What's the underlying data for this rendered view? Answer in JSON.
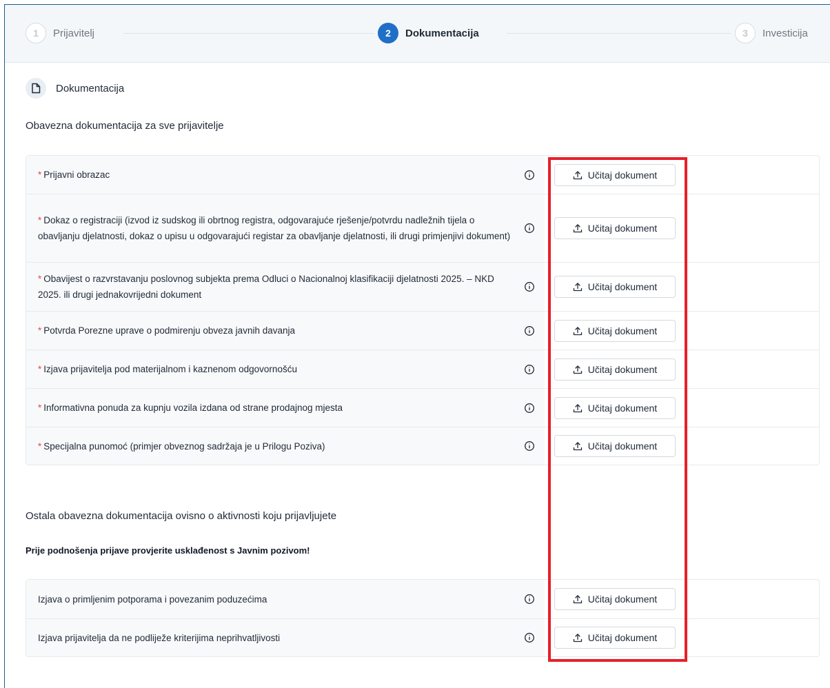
{
  "top_strip_text": "",
  "stepper": {
    "steps": [
      {
        "number": "1",
        "label": "Prijavitelj",
        "state": "inactive"
      },
      {
        "number": "2",
        "label": "Dokumentacija",
        "state": "active"
      },
      {
        "number": "3",
        "label": "Investicija",
        "state": "inactive"
      }
    ]
  },
  "section": {
    "icon": "document-icon",
    "title": "Dokumentacija"
  },
  "groups": [
    {
      "title": "Obavezna dokumentacija za sve prijavitelje",
      "warning": "",
      "rows": [
        {
          "required": "*",
          "label": "Prijavni obrazac",
          "button": "Učitaj dokument"
        },
        {
          "required": "*",
          "label": "Dokaz o registraciji (izvod iz sudskog ili obrtnog registra, odgovarajuće rješenje/potvrdu nadležnih tijela o obavljanju djelatnosti, dokaz o upisu u odgovarajući registar za obavljanje djelatnosti, ili drugi primjenjivi dokument)",
          "button": "Učitaj dokument"
        },
        {
          "required": "*",
          "label": "Obavijest o razvrstavanju poslovnog subjekta prema Odluci o Nacionalnoj klasifikaciji djelatnosti 2025. – NKD 2025. ili drugi jednakovrijedni dokument",
          "button": "Učitaj dokument"
        },
        {
          "required": "*",
          "label": "Potvrda Porezne uprave o podmirenju obveza javnih davanja",
          "button": "Učitaj dokument"
        },
        {
          "required": "*",
          "label": "Izjava prijavitelja pod materijalnom i kaznenom odgovornošću",
          "button": "Učitaj dokument"
        },
        {
          "required": "*",
          "label": "Informativna ponuda za kupnju vozila izdana od strane prodajnog mjesta",
          "button": "Učitaj dokument"
        },
        {
          "required": "*",
          "label": "Specijalna punomoć (primjer obveznog sadržaja je u Prilogu Poziva)",
          "button": "Učitaj dokument"
        }
      ]
    },
    {
      "title": "Ostala obavezna dokumentacija ovisno o aktivnosti koju prijavljujete",
      "warning": "Prije podnošenja prijave provjerite usklađenost s Javnim pozivom!",
      "rows": [
        {
          "required": "",
          "label": "Izjava o primljenim potporama i povezanim poduzećima",
          "button": "Učitaj dokument"
        },
        {
          "required": "",
          "label": "Izjava prijavitelja da ne podliježe kriterijima neprihvatljivosti",
          "button": "Učitaj dokument"
        }
      ]
    }
  ],
  "colors": {
    "accent": "#1f6fc9",
    "required": "#e5484d",
    "highlight": "#e5202a"
  }
}
